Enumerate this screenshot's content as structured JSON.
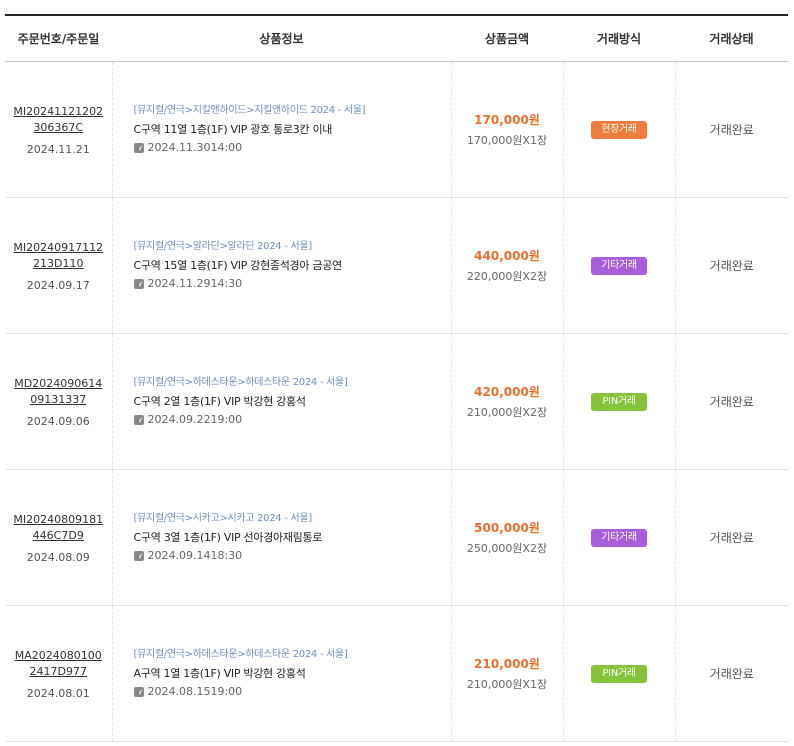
{
  "header": {
    "col_order": "주문번호/주문일",
    "col_info": "상품정보",
    "col_price": "상품금액",
    "col_method": "거래방식",
    "col_status": "거래상태"
  },
  "colors": {
    "method_onsite": "#f07c3c",
    "method_other": "#a85ed8",
    "method_pin": "#84c33a",
    "price": "#f06c2a",
    "category": "#6c8fc0"
  },
  "orders": [
    {
      "order_no": "MI20241121202306367C",
      "order_date": "2024.11.21",
      "category": "[뮤지컬/연극>지킬앤하이드>지킬앤하이드 2024 - 서울]",
      "seat": "C구역 11열 1층(1F) VIP 광호 통로3칸 이내",
      "show_date": "2024.11.3014:00",
      "total": "170,000원",
      "unit": "170,000원X1장",
      "method": "현장거래",
      "method_type": "onsite",
      "status": "거래완료"
    },
    {
      "order_no": "MI20240917112213D110",
      "order_date": "2024.09.17",
      "category": "[뮤지컬/연극>알라딘>알라딘 2024 - 서울]",
      "seat": "C구역 15열 1층(1F) VIP 강현종석경아 금공연",
      "show_date": "2024.11.2914:30",
      "total": "440,000원",
      "unit": "220,000원X2장",
      "method": "기타거래",
      "method_type": "other",
      "status": "거래완료"
    },
    {
      "order_no": "MD202409061409131337",
      "order_date": "2024.09.06",
      "category": "[뮤지컬/연극>하데스타운>하데스타운 2024 - 서울]",
      "seat": "C구역 2열 1층(1F) VIP 박강현 강홍석",
      "show_date": "2024.09.2219:00",
      "total": "420,000원",
      "unit": "210,000원X2장",
      "method": "PIN거래",
      "method_type": "pin",
      "status": "거래완료"
    },
    {
      "order_no": "MI20240809181446C7D9",
      "order_date": "2024.08.09",
      "category": "[뮤지컬/연극>시카고>시카고 2024 - 서울]",
      "seat": "C구역 3열 1층(1F) VIP 선아경아재림통로",
      "show_date": "2024.09.1418:30",
      "total": "500,000원",
      "unit": "250,000원X2장",
      "method": "기타거래",
      "method_type": "other",
      "status": "거래완료"
    },
    {
      "order_no": "MA20240801002417D977",
      "order_date": "2024.08.01",
      "category": "[뮤지컬/연극>하데스타운>하데스타운 2024 - 서울]",
      "seat": "A구역 1열 1층(1F) VIP 박강현 강홍석",
      "show_date": "2024.08.1519:00",
      "total": "210,000원",
      "unit": "210,000원X1장",
      "method": "PIN거래",
      "method_type": "pin",
      "status": "거래완료"
    }
  ]
}
